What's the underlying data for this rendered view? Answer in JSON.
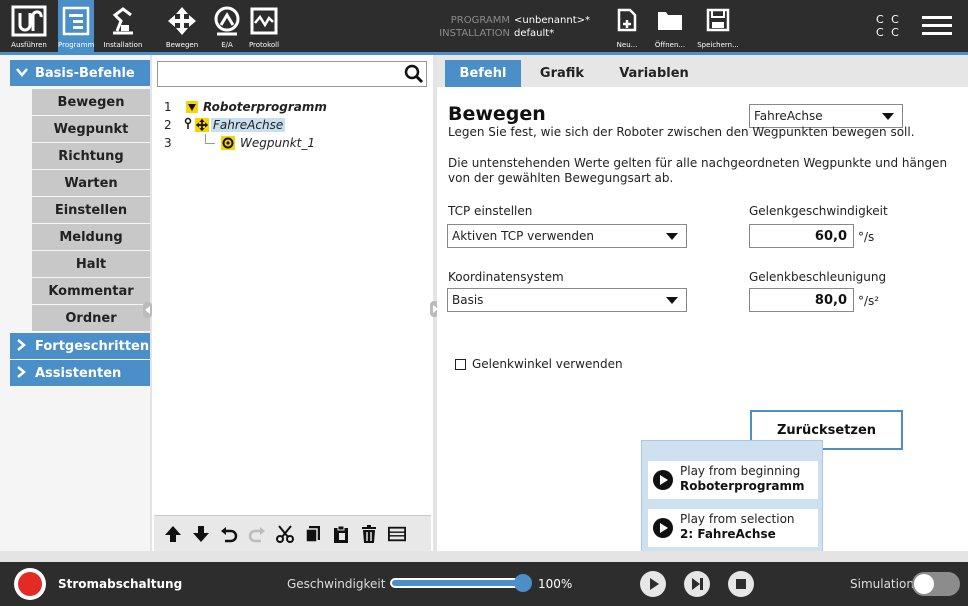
{
  "topbar": {
    "tabs": [
      {
        "label": "Ausführen",
        "icon": "ur-logo-icon"
      },
      {
        "label": "Programm",
        "icon": "program-icon",
        "active": true
      },
      {
        "label": "Installation",
        "icon": "installation-icon"
      },
      {
        "label": "Bewegen",
        "icon": "move-icon"
      },
      {
        "label": "E/A",
        "icon": "io-icon"
      },
      {
        "label": "Protokoll",
        "icon": "log-icon"
      }
    ],
    "program_key": "PROGRAMM",
    "program_value": "<unbenannt>*",
    "installation_key": "INSTALLATION",
    "installation_value": "default*",
    "file_buttons": [
      {
        "label": "Neu...",
        "icon": "new-file-icon"
      },
      {
        "label": "Öffnen...",
        "icon": "folder-icon"
      },
      {
        "label": "Speichern...",
        "icon": "save-icon"
      }
    ],
    "cc_line1": "C C",
    "cc_line2": "C C"
  },
  "sidebar": {
    "categories": [
      {
        "label": "Basis-Befehle",
        "expanded": true
      },
      {
        "label": "Fortgeschritten",
        "expanded": false
      },
      {
        "label": "Assistenten",
        "expanded": false
      }
    ],
    "commands": [
      "Bewegen",
      "Wegpunkt",
      "Richtung",
      "Warten",
      "Einstellen",
      "Meldung",
      "Halt",
      "Kommentar",
      "Ordner"
    ]
  },
  "tree": {
    "search_value": "",
    "rows": [
      {
        "num": "1",
        "label": "Roboterprogramm"
      },
      {
        "num": "2",
        "label": "FahreAchse"
      },
      {
        "num": "3",
        "label": "Wegpunkt_1"
      }
    ]
  },
  "editor": {
    "tabs": [
      "Befehl",
      "Grafik",
      "Variablen"
    ],
    "title": "Bewegen",
    "move_type": "FahreAchse",
    "desc1": "Legen Sie fest, wie sich der Roboter zwischen den Wegpunkten bewegen soll.",
    "desc2a": "Die untenstehenden Werte gelten für alle nachgeordneten Wegpunkte und hängen",
    "desc2b": "von der gewählten Bewegungsart ab.",
    "tcp_label": "TCP einstellen",
    "tcp_value": "Aktiven TCP verwenden",
    "coord_label": "Koordinatensystem",
    "coord_value": "Basis",
    "speed_label": "Gelenkgeschwindigkeit",
    "speed_value": "60,0",
    "speed_unit": "°/s",
    "accel_label": "Gelenkbeschleunigung",
    "accel_value": "80,0",
    "accel_unit": "°/s²",
    "joint_angles_label": "Gelenkwinkel verwenden",
    "reset_label": "Zurücksetzen"
  },
  "play_popup": {
    "option1_line1": "Play from beginning",
    "option1_line2": "Roboterprogramm",
    "option2_line1": "Play from selection",
    "option2_line2": "2: FahreAchse"
  },
  "bottombar": {
    "power_label": "Stromabschaltung",
    "speed_label": "Geschwindigkeit",
    "speed_percent": "100%",
    "speed_fraction": 1.0,
    "simulation_label": "Simulation"
  },
  "colors": {
    "accent": "#4a8fc7",
    "dark": "#2d2d2d",
    "power_red": "#e32b24"
  }
}
